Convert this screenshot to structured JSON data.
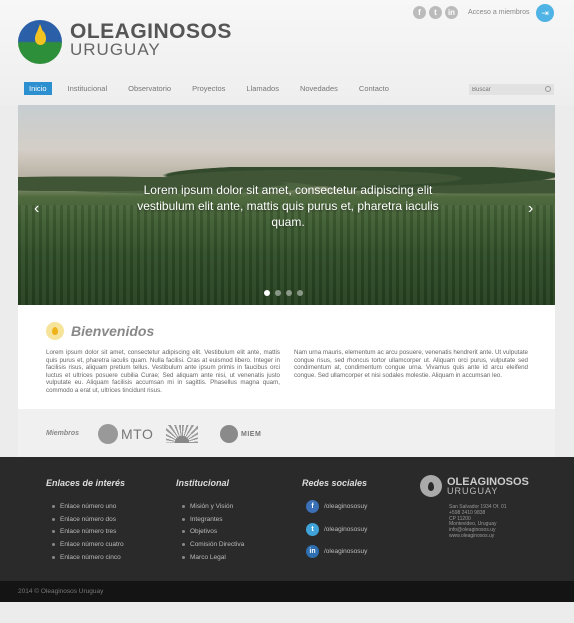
{
  "header": {
    "brand_line1": "OLEAGINOSOS",
    "brand_line2": "URUGUAY",
    "social_icons": [
      "facebook-icon",
      "twitter-icon",
      "linkedin-icon"
    ],
    "social_glyphs": [
      "f",
      "t",
      "in"
    ],
    "access_label": "Acceso a miembros",
    "access_glyph": "⇥"
  },
  "nav": {
    "items": [
      "Inicio",
      "Institucional",
      "Observatorio",
      "Proyectos",
      "Llamados",
      "Novedades",
      "Contacto"
    ],
    "active": "Inicio",
    "search_placeholder": "Buscar"
  },
  "hero": {
    "caption": "Lorem ipsum dolor sit amet, consectetur adipiscing elit vestibulum elit ante, mattis quis purus et, pharetra iaculis quam.",
    "prev_glyph": "‹",
    "next_glyph": "›",
    "slides": 4,
    "active_slide": 1
  },
  "welcome": {
    "title": "Bienvenidos",
    "col1": "Lorem ipsum dolor sit amet, consectetur adipiscing elit. Vestibulum elit ante, mattis quis purus et, pharetra iaculis quam. Nulla facilisi. Cras at euismod libero. Integer in facilisis risus, aliquam pretium tellus. Vestibulum ante ipsum primis in faucibus orci luctus et ultrices posuere cubilia Curae; Sed aliquam ante nisi, ut venenatis justo vulputate eu. Aliquam facilisis accumsan mi in sagittis. Phasellus magna quam, commodo a erat ut, ultrices tincidunt risus.",
    "col2": "Nam urna mauris, elementum ac arcu posuere, venenatis hendrerit ante. Ut vulputate congue risus, sed rhoncus tortor ullamcorper ut. Aliquam orci purus, vulputate sed condimentum at, condimentum congue urna. Vivamus quis ante id arcu eleifend congue. Sed ullamcorper et nisi sodales molestie. Aliquam in accumsan leo."
  },
  "members": {
    "label": "Miembros",
    "logos": [
      "MTO",
      "MIEM"
    ]
  },
  "footer": {
    "links_title": "Enlaces de interés",
    "links": [
      "Enlace número uno",
      "Enlace número dos",
      "Enlace número tres",
      "Enlace número cuatro",
      "Enlace número cinco"
    ],
    "institucional_title": "Institucional",
    "institucional": [
      "Misión y Visión",
      "Integrantes",
      "Objetivos",
      "Comisión Directiva",
      "Marco Legal"
    ],
    "social_title": "Redes sociales",
    "social": [
      {
        "icon": "facebook-icon",
        "glyph": "f",
        "label": "/oleaginososuy"
      },
      {
        "icon": "twitter-icon",
        "glyph": "t",
        "label": "/oleaginososuy"
      },
      {
        "icon": "linkedin-icon",
        "glyph": "in",
        "label": "/oleaginososuy"
      }
    ],
    "brand_line1": "OLEAGINOSOS",
    "brand_line2": "URUGUAY",
    "address": [
      "San Salvador 1934 Of. 01",
      "+598 2410 9838",
      "CP 11200",
      "Montevideo, Uruguay",
      "info@oleaginosos.uy",
      "www.oleaginosos.uy"
    ],
    "copyright": "2014 © Oleaginosos Uruguay"
  },
  "colors": {
    "accent": "#2b8fd0",
    "footer_bg": "#2a2a2a",
    "bottom_bg": "#141414"
  }
}
